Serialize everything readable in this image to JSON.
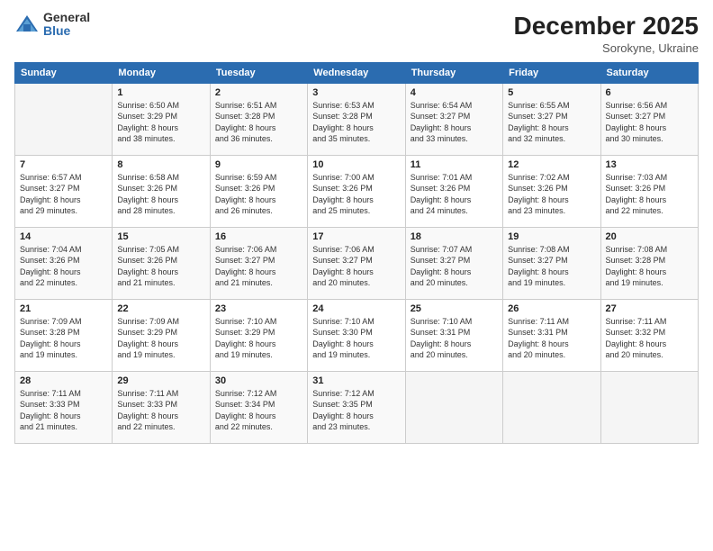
{
  "logo": {
    "general": "General",
    "blue": "Blue"
  },
  "header": {
    "month": "December 2025",
    "location": "Sorokyne, Ukraine"
  },
  "weekdays": [
    "Sunday",
    "Monday",
    "Tuesday",
    "Wednesday",
    "Thursday",
    "Friday",
    "Saturday"
  ],
  "weeks": [
    [
      {
        "day": "",
        "info": ""
      },
      {
        "day": "1",
        "info": "Sunrise: 6:50 AM\nSunset: 3:29 PM\nDaylight: 8 hours\nand 38 minutes."
      },
      {
        "day": "2",
        "info": "Sunrise: 6:51 AM\nSunset: 3:28 PM\nDaylight: 8 hours\nand 36 minutes."
      },
      {
        "day": "3",
        "info": "Sunrise: 6:53 AM\nSunset: 3:28 PM\nDaylight: 8 hours\nand 35 minutes."
      },
      {
        "day": "4",
        "info": "Sunrise: 6:54 AM\nSunset: 3:27 PM\nDaylight: 8 hours\nand 33 minutes."
      },
      {
        "day": "5",
        "info": "Sunrise: 6:55 AM\nSunset: 3:27 PM\nDaylight: 8 hours\nand 32 minutes."
      },
      {
        "day": "6",
        "info": "Sunrise: 6:56 AM\nSunset: 3:27 PM\nDaylight: 8 hours\nand 30 minutes."
      }
    ],
    [
      {
        "day": "7",
        "info": "Sunrise: 6:57 AM\nSunset: 3:27 PM\nDaylight: 8 hours\nand 29 minutes."
      },
      {
        "day": "8",
        "info": "Sunrise: 6:58 AM\nSunset: 3:26 PM\nDaylight: 8 hours\nand 28 minutes."
      },
      {
        "day": "9",
        "info": "Sunrise: 6:59 AM\nSunset: 3:26 PM\nDaylight: 8 hours\nand 26 minutes."
      },
      {
        "day": "10",
        "info": "Sunrise: 7:00 AM\nSunset: 3:26 PM\nDaylight: 8 hours\nand 25 minutes."
      },
      {
        "day": "11",
        "info": "Sunrise: 7:01 AM\nSunset: 3:26 PM\nDaylight: 8 hours\nand 24 minutes."
      },
      {
        "day": "12",
        "info": "Sunrise: 7:02 AM\nSunset: 3:26 PM\nDaylight: 8 hours\nand 23 minutes."
      },
      {
        "day": "13",
        "info": "Sunrise: 7:03 AM\nSunset: 3:26 PM\nDaylight: 8 hours\nand 22 minutes."
      }
    ],
    [
      {
        "day": "14",
        "info": "Sunrise: 7:04 AM\nSunset: 3:26 PM\nDaylight: 8 hours\nand 22 minutes."
      },
      {
        "day": "15",
        "info": "Sunrise: 7:05 AM\nSunset: 3:26 PM\nDaylight: 8 hours\nand 21 minutes."
      },
      {
        "day": "16",
        "info": "Sunrise: 7:06 AM\nSunset: 3:27 PM\nDaylight: 8 hours\nand 21 minutes."
      },
      {
        "day": "17",
        "info": "Sunrise: 7:06 AM\nSunset: 3:27 PM\nDaylight: 8 hours\nand 20 minutes."
      },
      {
        "day": "18",
        "info": "Sunrise: 7:07 AM\nSunset: 3:27 PM\nDaylight: 8 hours\nand 20 minutes."
      },
      {
        "day": "19",
        "info": "Sunrise: 7:08 AM\nSunset: 3:27 PM\nDaylight: 8 hours\nand 19 minutes."
      },
      {
        "day": "20",
        "info": "Sunrise: 7:08 AM\nSunset: 3:28 PM\nDaylight: 8 hours\nand 19 minutes."
      }
    ],
    [
      {
        "day": "21",
        "info": "Sunrise: 7:09 AM\nSunset: 3:28 PM\nDaylight: 8 hours\nand 19 minutes."
      },
      {
        "day": "22",
        "info": "Sunrise: 7:09 AM\nSunset: 3:29 PM\nDaylight: 8 hours\nand 19 minutes."
      },
      {
        "day": "23",
        "info": "Sunrise: 7:10 AM\nSunset: 3:29 PM\nDaylight: 8 hours\nand 19 minutes."
      },
      {
        "day": "24",
        "info": "Sunrise: 7:10 AM\nSunset: 3:30 PM\nDaylight: 8 hours\nand 19 minutes."
      },
      {
        "day": "25",
        "info": "Sunrise: 7:10 AM\nSunset: 3:31 PM\nDaylight: 8 hours\nand 20 minutes."
      },
      {
        "day": "26",
        "info": "Sunrise: 7:11 AM\nSunset: 3:31 PM\nDaylight: 8 hours\nand 20 minutes."
      },
      {
        "day": "27",
        "info": "Sunrise: 7:11 AM\nSunset: 3:32 PM\nDaylight: 8 hours\nand 20 minutes."
      }
    ],
    [
      {
        "day": "28",
        "info": "Sunrise: 7:11 AM\nSunset: 3:33 PM\nDaylight: 8 hours\nand 21 minutes."
      },
      {
        "day": "29",
        "info": "Sunrise: 7:11 AM\nSunset: 3:33 PM\nDaylight: 8 hours\nand 22 minutes."
      },
      {
        "day": "30",
        "info": "Sunrise: 7:12 AM\nSunset: 3:34 PM\nDaylight: 8 hours\nand 22 minutes."
      },
      {
        "day": "31",
        "info": "Sunrise: 7:12 AM\nSunset: 3:35 PM\nDaylight: 8 hours\nand 23 minutes."
      },
      {
        "day": "",
        "info": ""
      },
      {
        "day": "",
        "info": ""
      },
      {
        "day": "",
        "info": ""
      }
    ]
  ]
}
